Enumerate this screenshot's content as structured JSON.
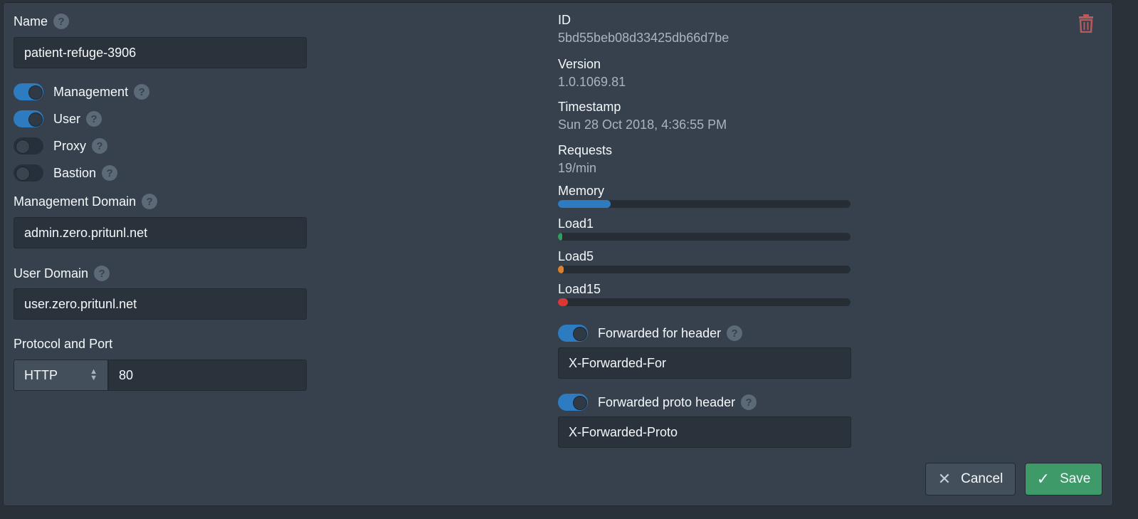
{
  "name": {
    "label": "Name",
    "value": "patient-refuge-3906"
  },
  "toggles": [
    {
      "label": "Management",
      "on": true
    },
    {
      "label": "User",
      "on": true
    },
    {
      "label": "Proxy",
      "on": false
    },
    {
      "label": "Bastion",
      "on": false
    }
  ],
  "management_domain": {
    "label": "Management Domain",
    "value": "admin.zero.pritunl.net"
  },
  "user_domain": {
    "label": "User Domain",
    "value": "user.zero.pritunl.net"
  },
  "protocol": {
    "label": "Protocol and Port",
    "protocol": "HTTP",
    "port": "80"
  },
  "info": {
    "id_label": "ID",
    "id": "5bd55beb08d33425db66d7be",
    "version_label": "Version",
    "version": "1.0.1069.81",
    "timestamp_label": "Timestamp",
    "timestamp": "Sun 28 Oct 2018, 4:36:55 PM",
    "requests_label": "Requests",
    "requests": "19/min"
  },
  "bars": [
    {
      "label": "Memory",
      "percent": 18,
      "color": "#2d7cc1"
    },
    {
      "label": "Load1",
      "percent": 1.5,
      "color": "#2f9e5f"
    },
    {
      "label": "Load5",
      "percent": 2,
      "color": "#d9822b"
    },
    {
      "label": "Load15",
      "percent": 3.5,
      "color": "#db3737"
    }
  ],
  "forwarded_for": {
    "label": "Forwarded for header",
    "on": true,
    "value": "X-Forwarded-For"
  },
  "forwarded_proto": {
    "label": "Forwarded proto header",
    "on": true,
    "value": "X-Forwarded-Proto"
  },
  "actions": {
    "cancel": "Cancel",
    "save": "Save"
  },
  "colors": {
    "accent": "#2d7cc1",
    "save": "#3f9a6a",
    "delete": "#b65a5a"
  }
}
